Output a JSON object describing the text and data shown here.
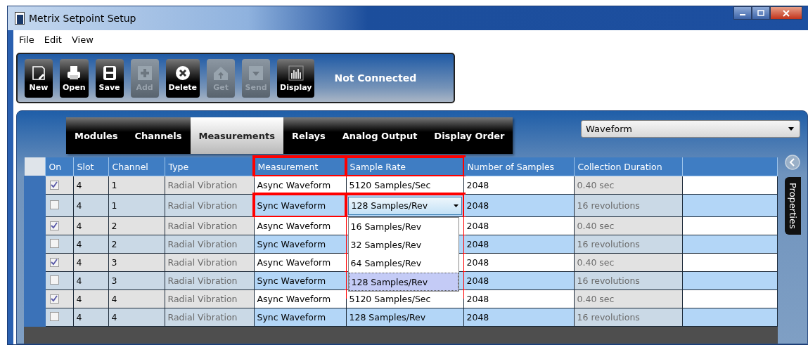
{
  "window": {
    "title": "Metrix Setpoint Setup"
  },
  "menu": [
    "File",
    "Edit",
    "View"
  ],
  "toolbar": {
    "buttons": [
      {
        "label": "New",
        "disabled": false
      },
      {
        "label": "Open",
        "disabled": false
      },
      {
        "label": "Save",
        "disabled": false
      },
      {
        "label": "Add",
        "disabled": true
      },
      {
        "label": "Delete",
        "disabled": false
      },
      {
        "label": "Get",
        "disabled": true
      },
      {
        "label": "Send",
        "disabled": true
      },
      {
        "label": "Display",
        "disabled": false
      }
    ],
    "status": "Not Connected"
  },
  "tabs": [
    {
      "label": "Modules",
      "selected": false
    },
    {
      "label": "Channels",
      "selected": false
    },
    {
      "label": "Measurements",
      "selected": true
    },
    {
      "label": "Relays",
      "selected": false
    },
    {
      "label": "Analog Output",
      "selected": false
    },
    {
      "label": "Display Order",
      "selected": false
    }
  ],
  "filter": {
    "value": "Waveform"
  },
  "table": {
    "columns": [
      {
        "label": "On",
        "highlighted": false
      },
      {
        "label": "Slot",
        "highlighted": false
      },
      {
        "label": "Channel",
        "highlighted": false
      },
      {
        "label": "Type",
        "highlighted": false
      },
      {
        "label": "Measurement",
        "highlighted": true
      },
      {
        "label": "Sample Rate",
        "highlighted": true
      },
      {
        "label": "Number of Samples",
        "highlighted": false
      },
      {
        "label": "Collection Duration",
        "highlighted": false
      }
    ],
    "rows": [
      {
        "on": true,
        "slot": "4",
        "channel": "1",
        "type": "Radial Vibration",
        "measurement": "Async Waveform",
        "measurement_highlighted": false,
        "sample_rate": "5120 Samples/Sec",
        "samples": "2048",
        "duration": "0.40 sec"
      },
      {
        "on": false,
        "slot": "4",
        "channel": "1",
        "type": "Radial Vibration",
        "measurement": "Sync Waveform",
        "measurement_highlighted": true,
        "sample_rate": "128 Samples/Rev",
        "editing": true,
        "samples": "2048",
        "duration": "16 revolutions"
      },
      {
        "on": true,
        "slot": "4",
        "channel": "2",
        "type": "Radial Vibration",
        "measurement": "Async Waveform",
        "measurement_highlighted": false,
        "samples": "2048",
        "duration": "0.40 sec"
      },
      {
        "on": false,
        "slot": "4",
        "channel": "2",
        "type": "Radial Vibration",
        "measurement": "Sync Waveform",
        "measurement_highlighted": false,
        "samples": "2048",
        "duration": "16 revolutions"
      },
      {
        "on": true,
        "slot": "4",
        "channel": "3",
        "type": "Radial Vibration",
        "measurement": "Async Waveform",
        "measurement_highlighted": false,
        "samples": "2048",
        "duration": "0.40 sec"
      },
      {
        "on": false,
        "slot": "4",
        "channel": "3",
        "type": "Radial Vibration",
        "measurement": "Sync Waveform",
        "measurement_highlighted": false,
        "samples": "2048",
        "duration": "16 revolutions"
      },
      {
        "on": true,
        "slot": "4",
        "channel": "4",
        "type": "Radial Vibration",
        "measurement": "Async Waveform",
        "measurement_highlighted": false,
        "sample_rate": "5120 Samples/Sec",
        "samples": "2048",
        "duration": "0.40 sec"
      },
      {
        "on": false,
        "slot": "4",
        "channel": "4",
        "type": "Radial Vibration",
        "measurement": "Sync Waveform",
        "measurement_highlighted": false,
        "sample_rate": "128 Samples/Rev",
        "samples": "2048",
        "duration": "16 revolutions"
      }
    ]
  },
  "dropdown_list": {
    "highlighted": true,
    "options": [
      {
        "label": "16 Samples/Rev",
        "selected": false
      },
      {
        "label": "32 Samples/Rev",
        "selected": false
      },
      {
        "label": "64 Samples/Rev",
        "selected": false
      },
      {
        "label": "128 Samples/Rev",
        "selected": true
      }
    ]
  },
  "side_panel": {
    "label": "Properties"
  }
}
